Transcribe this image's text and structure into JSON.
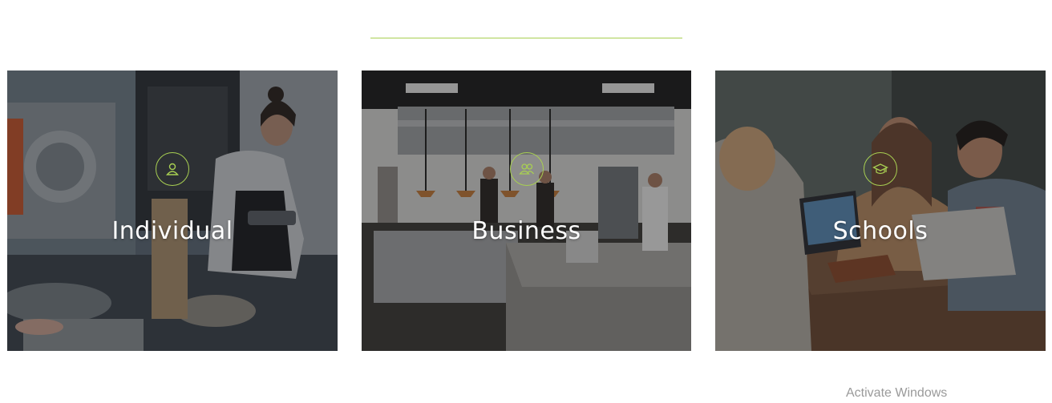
{
  "colors": {
    "accent": "#a8cf52",
    "overlay": "rgba(20,20,20,0.38)",
    "text": "#ffffff"
  },
  "cards": [
    {
      "title": "Individual",
      "icon": "person-icon"
    },
    {
      "title": "Business",
      "icon": "group-icon"
    },
    {
      "title": "Schools",
      "icon": "graduation-cap-icon"
    }
  ],
  "watermark": "Activate Windows"
}
